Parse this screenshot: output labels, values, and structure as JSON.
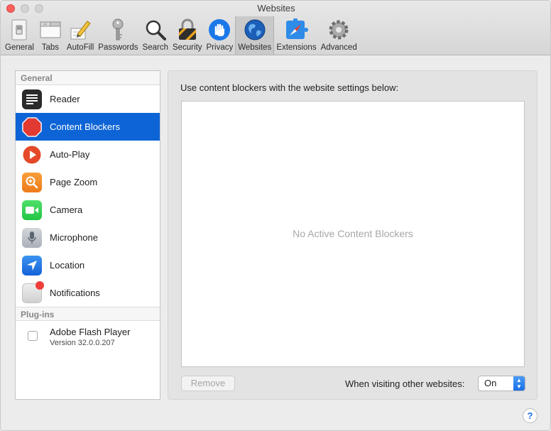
{
  "window": {
    "title": "Websites"
  },
  "toolbar": {
    "tabs": [
      {
        "label": "General",
        "icon": "general-switch-icon"
      },
      {
        "label": "Tabs",
        "icon": "tabs-icon"
      },
      {
        "label": "AutoFill",
        "icon": "autofill-pencil-icon"
      },
      {
        "label": "Passwords",
        "icon": "key-icon"
      },
      {
        "label": "Search",
        "icon": "magnifier-icon"
      },
      {
        "label": "Security",
        "icon": "padlock-icon"
      },
      {
        "label": "Privacy",
        "icon": "hand-icon"
      },
      {
        "label": "Websites",
        "icon": "globe-icon",
        "active": true
      },
      {
        "label": "Extensions",
        "icon": "puzzle-compass-icon"
      },
      {
        "label": "Advanced",
        "icon": "gear-icon"
      }
    ]
  },
  "sidebar": {
    "general_header": "General",
    "items": [
      {
        "label": "Reader",
        "icon": "reader-icon"
      },
      {
        "label": "Content Blockers",
        "icon": "stop-sign-icon",
        "selected": true
      },
      {
        "label": "Auto-Play",
        "icon": "play-icon"
      },
      {
        "label": "Page Zoom",
        "icon": "zoom-icon"
      },
      {
        "label": "Camera",
        "icon": "camera-icon"
      },
      {
        "label": "Microphone",
        "icon": "microphone-icon"
      },
      {
        "label": "Location",
        "icon": "location-arrow-icon"
      },
      {
        "label": "Notifications",
        "icon": "notifications-icon"
      }
    ],
    "plugins_header": "Plug-ins",
    "plugins": [
      {
        "name": "Adobe Flash Player",
        "version": "Version 32.0.0.207",
        "checked": false
      }
    ]
  },
  "panel": {
    "title": "Use content blockers with the website settings below:",
    "empty_message": "No Active Content Blockers",
    "remove_label": "Remove",
    "visiting_label": "When visiting other websites:",
    "visiting_value": "On"
  },
  "help": {
    "label": "?"
  },
  "colors": {
    "accent": "#0d64d6",
    "close": "#fc605c"
  }
}
